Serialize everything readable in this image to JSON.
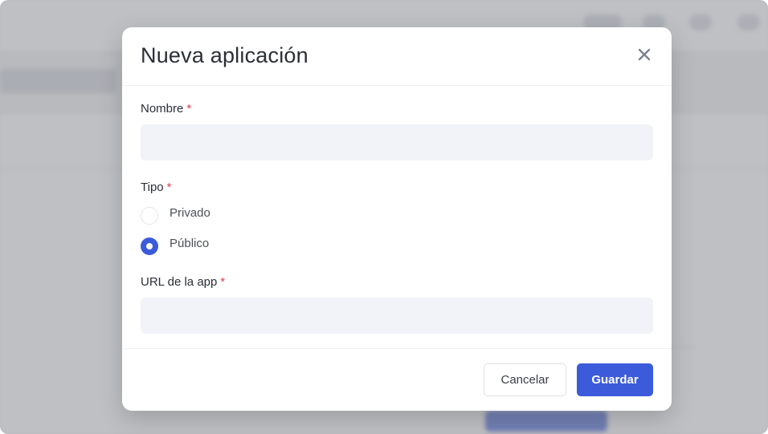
{
  "modal": {
    "title": "Nueva aplicación",
    "close_icon": "close-icon",
    "fields": {
      "name": {
        "label": "Nombre",
        "required_mark": "*",
        "value": "",
        "placeholder": ""
      },
      "type": {
        "label": "Tipo",
        "required_mark": "*",
        "options": [
          {
            "label": "Privado",
            "selected": false
          },
          {
            "label": "Público",
            "selected": true
          }
        ]
      },
      "url": {
        "label": "URL de la app",
        "required_mark": "*",
        "value": "",
        "placeholder": ""
      }
    },
    "footer": {
      "cancel_label": "Cancelar",
      "save_label": "Guardar"
    }
  },
  "colors": {
    "accent": "#3b5bdb",
    "required": "#e03e4c",
    "input_bg": "#f2f3f8"
  }
}
